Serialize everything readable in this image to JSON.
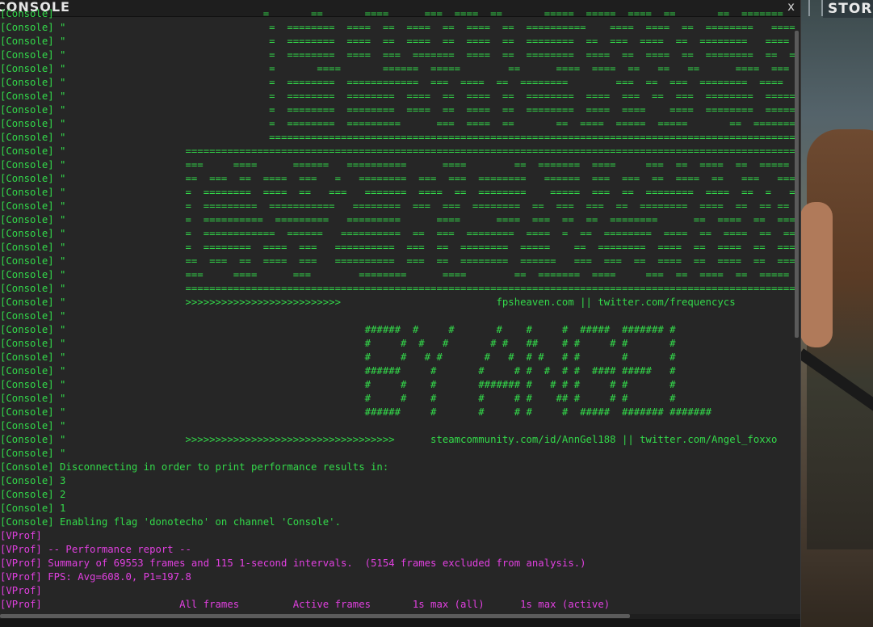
{
  "window": {
    "title": "CONSOLE",
    "close_label": "x"
  },
  "game_hud": {
    "label": "STOR"
  },
  "colors": {
    "console_channel": "#33d94a",
    "vprof_channel": "#e140e0"
  },
  "log_lines": [
    {
      "channel": "console",
      "text": "[Console]                                   =       ==       ====      ===  ====  ==       =====  =====  ====  ==       ==  =======  ="
    },
    {
      "channel": "console",
      "text": "[Console] \"                                  =  ========  ====  ==  ====  ==  ====  ==  ==========    ====  ====  ==  ========   ====  ="
    },
    {
      "channel": "console",
      "text": "[Console] \"                                  =  ========  ====  ==  ====  ==  ====  ==  ========  ==  ===  ====  ==  ========   ====  ="
    },
    {
      "channel": "console",
      "text": "[Console] \"                                  =  ========  ====  ===  =======  ====  ==  ========  ====  ==  ====  ==  ========  ==  ===  ="
    },
    {
      "channel": "console",
      "text": "[Console] \"                                  =       ====       ======  =====        ==      ====  ====  ==   ==   ==      ====  ===  ==  ="
    },
    {
      "channel": "console",
      "text": "[Console] \"                                  =  ========  ============  ===  ====  ==  ========        ===  ==  ===  ========  ====  =  ="
    },
    {
      "channel": "console",
      "text": "[Console] \"                                  =  ========  ========  ====  ==  ====  ==  ========  ====  ===  ==  ===  ========  ======   ="
    },
    {
      "channel": "console",
      "text": "[Console] \"                                  =  ========  ========  ====  ==  ====  ==  ========  ====  ====    ====  ========  ======   ="
    },
    {
      "channel": "console",
      "text": "[Console] \"                                  =  ========  =========      ===  ====  ==       ==  ====  =====  =====       ==  =======  ="
    },
    {
      "channel": "console",
      "text": "[Console] \"                                  ======================================================================================================="
    },
    {
      "channel": "console",
      "text": "[Console] \"                    ============================================================================================================"
    },
    {
      "channel": "console",
      "text": "[Console] \"                    ===     ====      ======   ==========      ====        ==  =======  ====     ===  ==  ====  ==  =====  ====="
    },
    {
      "channel": "console",
      "text": "[Console] \"                    ==  ===  ==  ====  ===   =   ========  ===  ===  ========   ======  ===  ===  ==  ====  ==   ===   ====   ==="
    },
    {
      "channel": "console",
      "text": "[Console] \"                    =  ========  ====  ==   ===   =======  ====  ==  ========    =====  ===  ==  ========  ====  ==  =   =  ===  ==="
    },
    {
      "channel": "console",
      "text": "[Console] \"                    =  =========  ===========   ========  ===  ===  ========  ==  ===  ===  ==  ========  ====  ==  == ==  ===  ==="
    },
    {
      "channel": "console",
      "text": "[Console] \"                    =  ==========  =========   =========      ====      ====  ===  ==  ==  ========      ==  ====  ==  ====  ==="
    },
    {
      "channel": "console",
      "text": "[Console] \"                    =  ============  ======   ==========  ==  ===  ========  ====  =  ==  ========  ====  ==  ====  ==  ====  ==="
    },
    {
      "channel": "console",
      "text": "[Console] \"                    =  ========  ====  ===   ==========  ===  ==  ========  =====    ==  ========  ====  ==  ====  ==  ====  ==="
    },
    {
      "channel": "console",
      "text": "[Console] \"                    ==  ===  ==  ====  ===   ==========  ===  ==  ========  ======   ===  ===  ==  ====  ==  ====  ==  ====  ==="
    },
    {
      "channel": "console",
      "text": "[Console] \"                    ===     ====      ===        ========      ====        ==  =======  ====     ===  ==  ====  ==  =====  ====="
    },
    {
      "channel": "console",
      "text": "[Console] \"                    ============================================================================================================"
    },
    {
      "channel": "console",
      "text": "[Console] \"                    >>>>>>>>>>>>>>>>>>>>>>>>>>                          fpsheaven.com || twitter.com/frequencycs                    <<<<<<<"
    },
    {
      "channel": "console",
      "text": "[Console] \""
    },
    {
      "channel": "console",
      "text": "[Console] \"                                                  ######  #     #       #    #     #  #####  ####### #"
    },
    {
      "channel": "console",
      "text": "[Console] \"                                                  #     #  #   #       # #   ##    # #     # #       #"
    },
    {
      "channel": "console",
      "text": "[Console] \"                                                  #     #   # #       #   #  # #   # #       #       #"
    },
    {
      "channel": "console",
      "text": "[Console] \"                                                  ######     #       #     # #  #  # #  #### #####   #"
    },
    {
      "channel": "console",
      "text": "[Console] \"                                                  #     #    #       ####### #   # # #     # #       #"
    },
    {
      "channel": "console",
      "text": "[Console] \"                                                  #     #    #       #     # #    ## #     # #       #"
    },
    {
      "channel": "console",
      "text": "[Console] \"                                                  ######     #       #     # #     #  #####  ####### #######"
    },
    {
      "channel": "console",
      "text": "[Console] \""
    },
    {
      "channel": "console",
      "text": "[Console] \"                    >>>>>>>>>>>>>>>>>>>>>>>>>>>>>>>>>>>      steamcommunity.com/id/AnnGel188 || twitter.com/Angel_foxxo      <<<<<<<<<<<<<<<<"
    },
    {
      "channel": "console",
      "text": "[Console] \""
    },
    {
      "channel": "console",
      "text": "[Console] Disconnecting in order to print performance results in:"
    },
    {
      "channel": "console",
      "text": "[Console] 3"
    },
    {
      "channel": "console",
      "text": "[Console] 2"
    },
    {
      "channel": "console",
      "text": "[Console] 1"
    },
    {
      "channel": "console",
      "text": "[Console] Enabling flag 'donotecho' on channel 'Console'."
    },
    {
      "channel": "vprof",
      "text": "[VProf]"
    },
    {
      "channel": "vprof",
      "text": "[VProf] -- Performance report --"
    },
    {
      "channel": "vprof",
      "text": "[VProf] Summary of 69553 frames and 115 1-second intervals.  (5154 frames excluded from analysis.)"
    },
    {
      "channel": "vprof",
      "text": "[VProf] FPS: Avg=608.0, P1=197.8"
    },
    {
      "channel": "vprof",
      "text": "[VProf]"
    },
    {
      "channel": "vprof",
      "text": "[VProf]                       All frames         Active frames       1s max (all)      1s max (active)"
    }
  ]
}
